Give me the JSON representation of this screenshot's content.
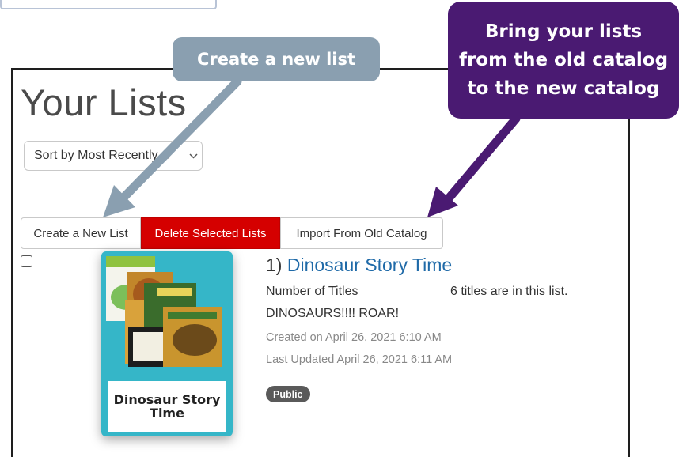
{
  "page": {
    "title": "Your Lists",
    "sort": {
      "selected": "Sort by Most Recently C"
    }
  },
  "toolbar": {
    "create_label": "Create a New List",
    "delete_label": "Delete Selected Lists",
    "import_label": "Import From Old Catalog"
  },
  "lists": [
    {
      "index": "1)",
      "name": "Dinosaur Story Time",
      "cover_label": "Dinosaur Story Time",
      "count_label": "Number of Titles",
      "count_value": "6 titles are in this list.",
      "description": "DINOSAURS!!!! ROAR!",
      "created": "Created on April 26, 2021 6:10 AM",
      "updated": "Last Updated April 26, 2021 6:11 AM",
      "badge": "Public"
    }
  ],
  "callouts": {
    "create": "Create a new list",
    "import_line1": "Bring your lists",
    "import_line2": "from the old catalog",
    "import_line3": "to the new catalog"
  },
  "colors": {
    "delete_button": "#d50000",
    "link": "#1f6aa8",
    "cover_bg": "#35b6c8",
    "callout_create": "#8a9fb0",
    "callout_import": "#4a1a72",
    "badge": "#5a5a5a"
  },
  "icons": {
    "sort_chevron": "chevron-down-icon"
  }
}
